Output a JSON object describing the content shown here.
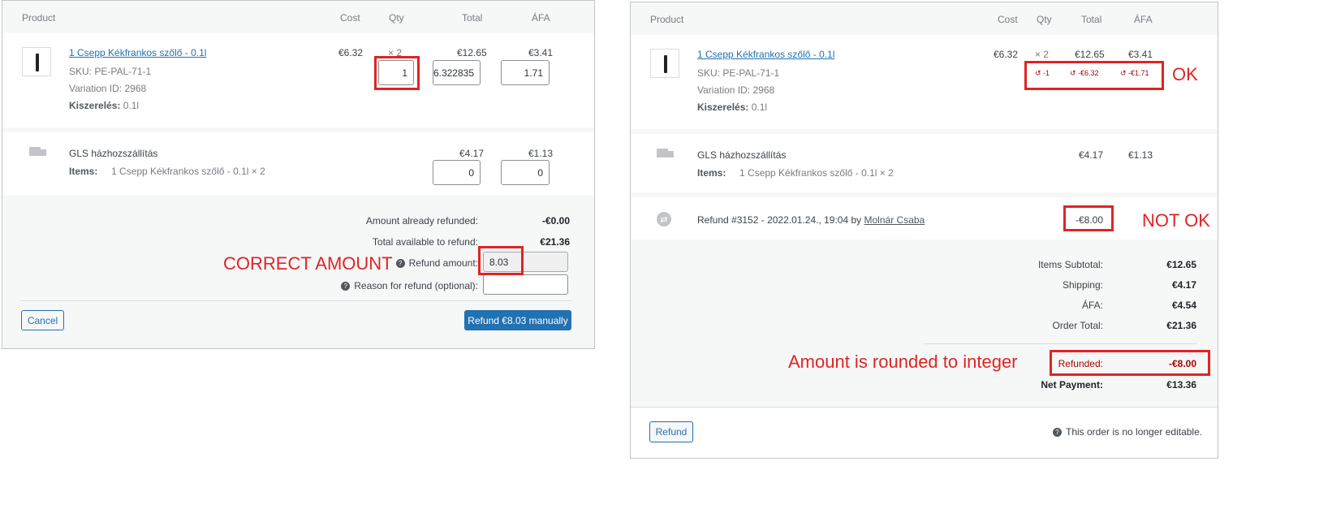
{
  "left": {
    "headers": {
      "product": "Product",
      "cost": "Cost",
      "qty": "Qty",
      "total": "Total",
      "tax": "ÁFA"
    },
    "item": {
      "name": "1 Csepp Kékfrankos szőlő - 0.1l",
      "sku_label": "SKU:",
      "sku": "PE-PAL-71-1",
      "variation_label": "Variation ID:",
      "variation": "2968",
      "attr_label": "Kiszerelés:",
      "attr": "0.1l",
      "cost": "€6.32",
      "qty": "× 2",
      "total": "€12.65",
      "tax": "€3.41",
      "refund_qty": "1",
      "refund_total": "6.322835",
      "refund_tax": "1.71"
    },
    "shipping": {
      "name": "GLS házhozszállítás",
      "items_label": "Items:",
      "items": "1 Csepp Kékfrankos szőlő - 0.1l × 2",
      "total": "€4.17",
      "tax": "€1.13",
      "refund_total": "0",
      "refund_tax": "0"
    },
    "summary": {
      "already_label": "Amount already refunded:",
      "already": "-€0.00",
      "available_label": "Total available to refund:",
      "available": "€21.36",
      "amount_label": "Refund amount:",
      "amount": "8.03",
      "reason_label": "Reason for refund (optional):"
    },
    "buttons": {
      "cancel": "Cancel",
      "refund": "Refund €8.03 manually"
    },
    "annotation": "CORRECT AMOUNT"
  },
  "right": {
    "headers": {
      "product": "Product",
      "cost": "Cost",
      "qty": "Qty",
      "total": "Total",
      "tax": "ÁFA"
    },
    "item": {
      "name": "1 Csepp Kékfrankos szőlő - 0.1l",
      "sku_label": "SKU:",
      "sku": "PE-PAL-71-1",
      "variation_label": "Variation ID:",
      "variation": "2968",
      "attr_label": "Kiszerelés:",
      "attr": "0.1l",
      "cost": "€6.32",
      "qty": "× 2",
      "total": "€12.65",
      "tax": "€3.41",
      "refunded_qty": "-1",
      "refunded_total": "-€6.32",
      "refunded_tax": "-€1.71"
    },
    "shipping": {
      "name": "GLS házhozszállítás",
      "items_label": "Items:",
      "items": "1 Csepp Kékfrankos szőlő - 0.1l × 2",
      "total": "€4.17",
      "tax": "€1.13"
    },
    "refund": {
      "text": "Refund #3152 - 2022.01.24., 19:04 by",
      "author": "Molnár Csaba",
      "amount": "-€8.00"
    },
    "totals": {
      "subtotal_label": "Items Subtotal:",
      "subtotal": "€12.65",
      "shipping_label": "Shipping:",
      "shipping": "€4.17",
      "tax_label": "ÁFA:",
      "tax": "€4.54",
      "order_total_label": "Order Total:",
      "order_total": "€21.36",
      "refunded_label": "Refunded:",
      "refunded": "-€8.00",
      "net_label": "Net Payment:",
      "net": "€13.36"
    },
    "buttons": {
      "refund": "Refund"
    },
    "not_editable": "This order is no longer editable.",
    "annotations": {
      "ok": "OK",
      "not_ok": "NOT OK",
      "rounded": "Amount is rounded to integer"
    }
  },
  "colors": {
    "annotation_red": "#e02424",
    "primary_blue": "#2271b1",
    "refund_red": "#a00"
  }
}
